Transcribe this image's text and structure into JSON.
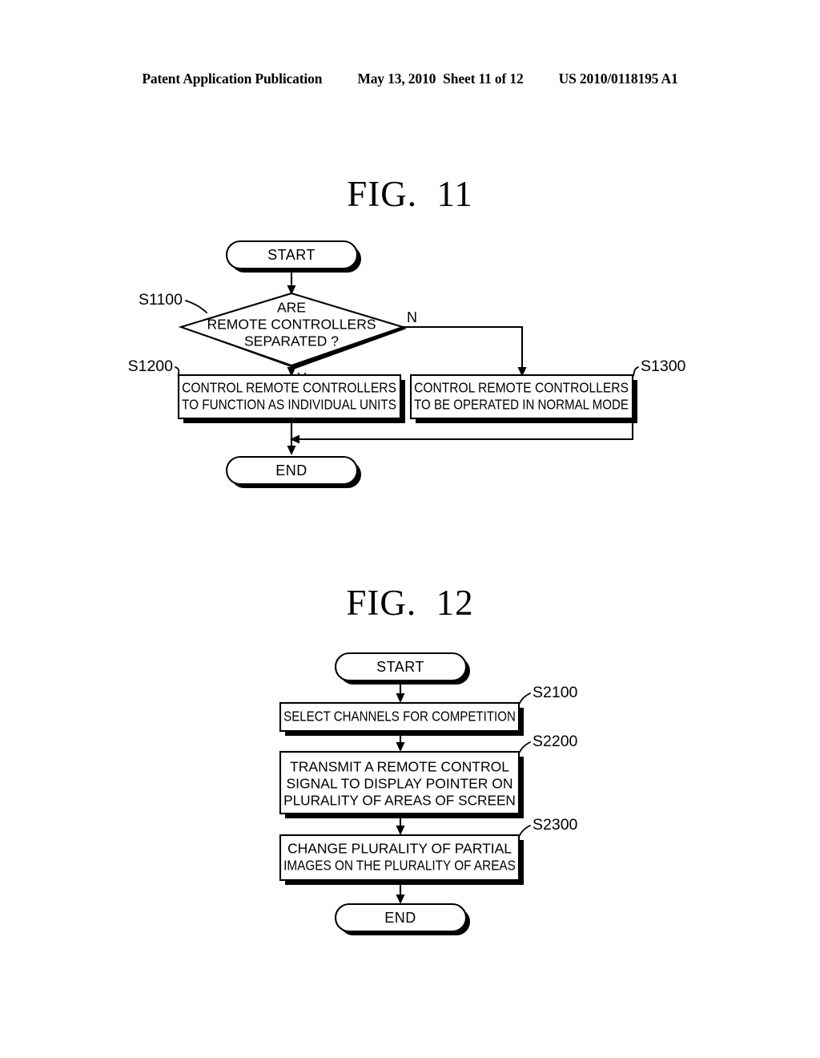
{
  "header": {
    "publication": "Patent Application Publication",
    "date": "May 13, 2010",
    "sheet": "Sheet 11 of 12",
    "patent_number": "US 2010/0118195 A1"
  },
  "figures": [
    {
      "title": "FIG.  11",
      "nodes": {
        "start": "START",
        "decision": {
          "line1": "ARE",
          "line2": "REMOTE CONTROLLERS",
          "line3": "SEPARATED ?",
          "ref": "S1100",
          "yes_label": "Y",
          "no_label": "N"
        },
        "process_yes": {
          "line1": "CONTROL REMOTE CONTROLLERS",
          "line2": "TO FUNCTION AS INDIVIDUAL UNITS",
          "ref": "S1200"
        },
        "process_no": {
          "line1": "CONTROL REMOTE CONTROLLERS",
          "line2": "TO BE OPERATED IN NORMAL MODE",
          "ref": "S1300"
        },
        "end": "END"
      }
    },
    {
      "title": "FIG.  12",
      "nodes": {
        "start": "START",
        "step1": {
          "line1": "SELECT CHANNELS FOR COMPETITION",
          "ref": "S2100"
        },
        "step2": {
          "line1": "TRANSMIT A REMOTE CONTROL",
          "line2": "SIGNAL TO DISPLAY POINTER ON",
          "line3": "PLURALITY OF AREAS OF SCREEN",
          "ref": "S2200"
        },
        "step3": {
          "line1": "CHANGE PLURALITY OF PARTIAL",
          "line2": "IMAGES ON THE PLURALITY OF AREAS",
          "ref": "S2300"
        },
        "end": "END"
      }
    }
  ],
  "colors": {
    "ink": "#000000",
    "paper": "#ffffff"
  }
}
